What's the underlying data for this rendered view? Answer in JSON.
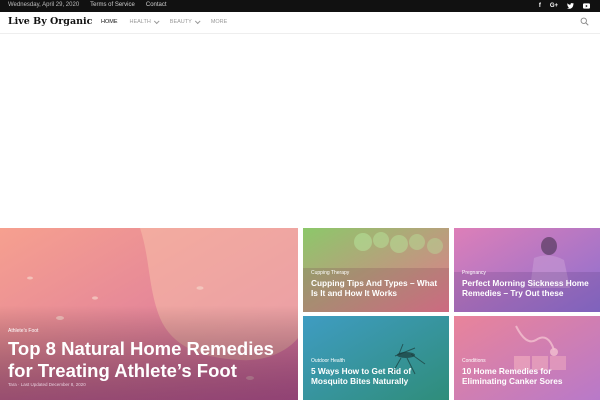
{
  "topbar": {
    "date": "Wednesday, April 29, 2020",
    "links": [
      "Terms of Service",
      "Contact"
    ],
    "social": [
      "f",
      "G+",
      "t",
      "yt"
    ]
  },
  "header": {
    "logo": "Live By Organic",
    "nav": [
      {
        "label": "HOME",
        "active": true
      },
      {
        "label": "HEALTH",
        "dropdown": true
      },
      {
        "label": "BEAUTY",
        "dropdown": true
      },
      {
        "label": "MORE"
      }
    ]
  },
  "posts": [
    {
      "category": "Athlete's Foot",
      "title_line1": "Top 8 Natural Home Remedies",
      "title_line2": "for Treating Athlete’s Foot",
      "meta": "Tara · Last Updated December 8, 2020"
    },
    {
      "category": "Cupping Therapy",
      "title_line1": "Cupping Tips And Types – What",
      "title_line2": "Is It and How It Works"
    },
    {
      "category": "Pregnancy",
      "title_line1": "Perfect Morning Sickness Home",
      "title_line2": "Remedies – Try Out these"
    },
    {
      "category": "Outdoor Health",
      "title_line1": "5 Ways How to Get Rid of",
      "title_line2": "Mosquito Bites Naturally"
    },
    {
      "category": "Conditions",
      "title_line1": "10 Home Remedies for",
      "title_line2": "Eliminating Canker Sores"
    }
  ],
  "colors": {
    "topbar_bg": "#111111",
    "feature_gradient": [
      "#f6a08f",
      "#d8709f"
    ],
    "cupping_gradient": [
      "#7ec36a",
      "#e47a8c"
    ],
    "pregnancy_gradient": [
      "#d47cba",
      "#8a6fd0"
    ],
    "mosquito_gradient": [
      "#3b9bb0",
      "#2f8f7f"
    ],
    "canker_gradient": [
      "#e8809a",
      "#b879c9"
    ]
  }
}
